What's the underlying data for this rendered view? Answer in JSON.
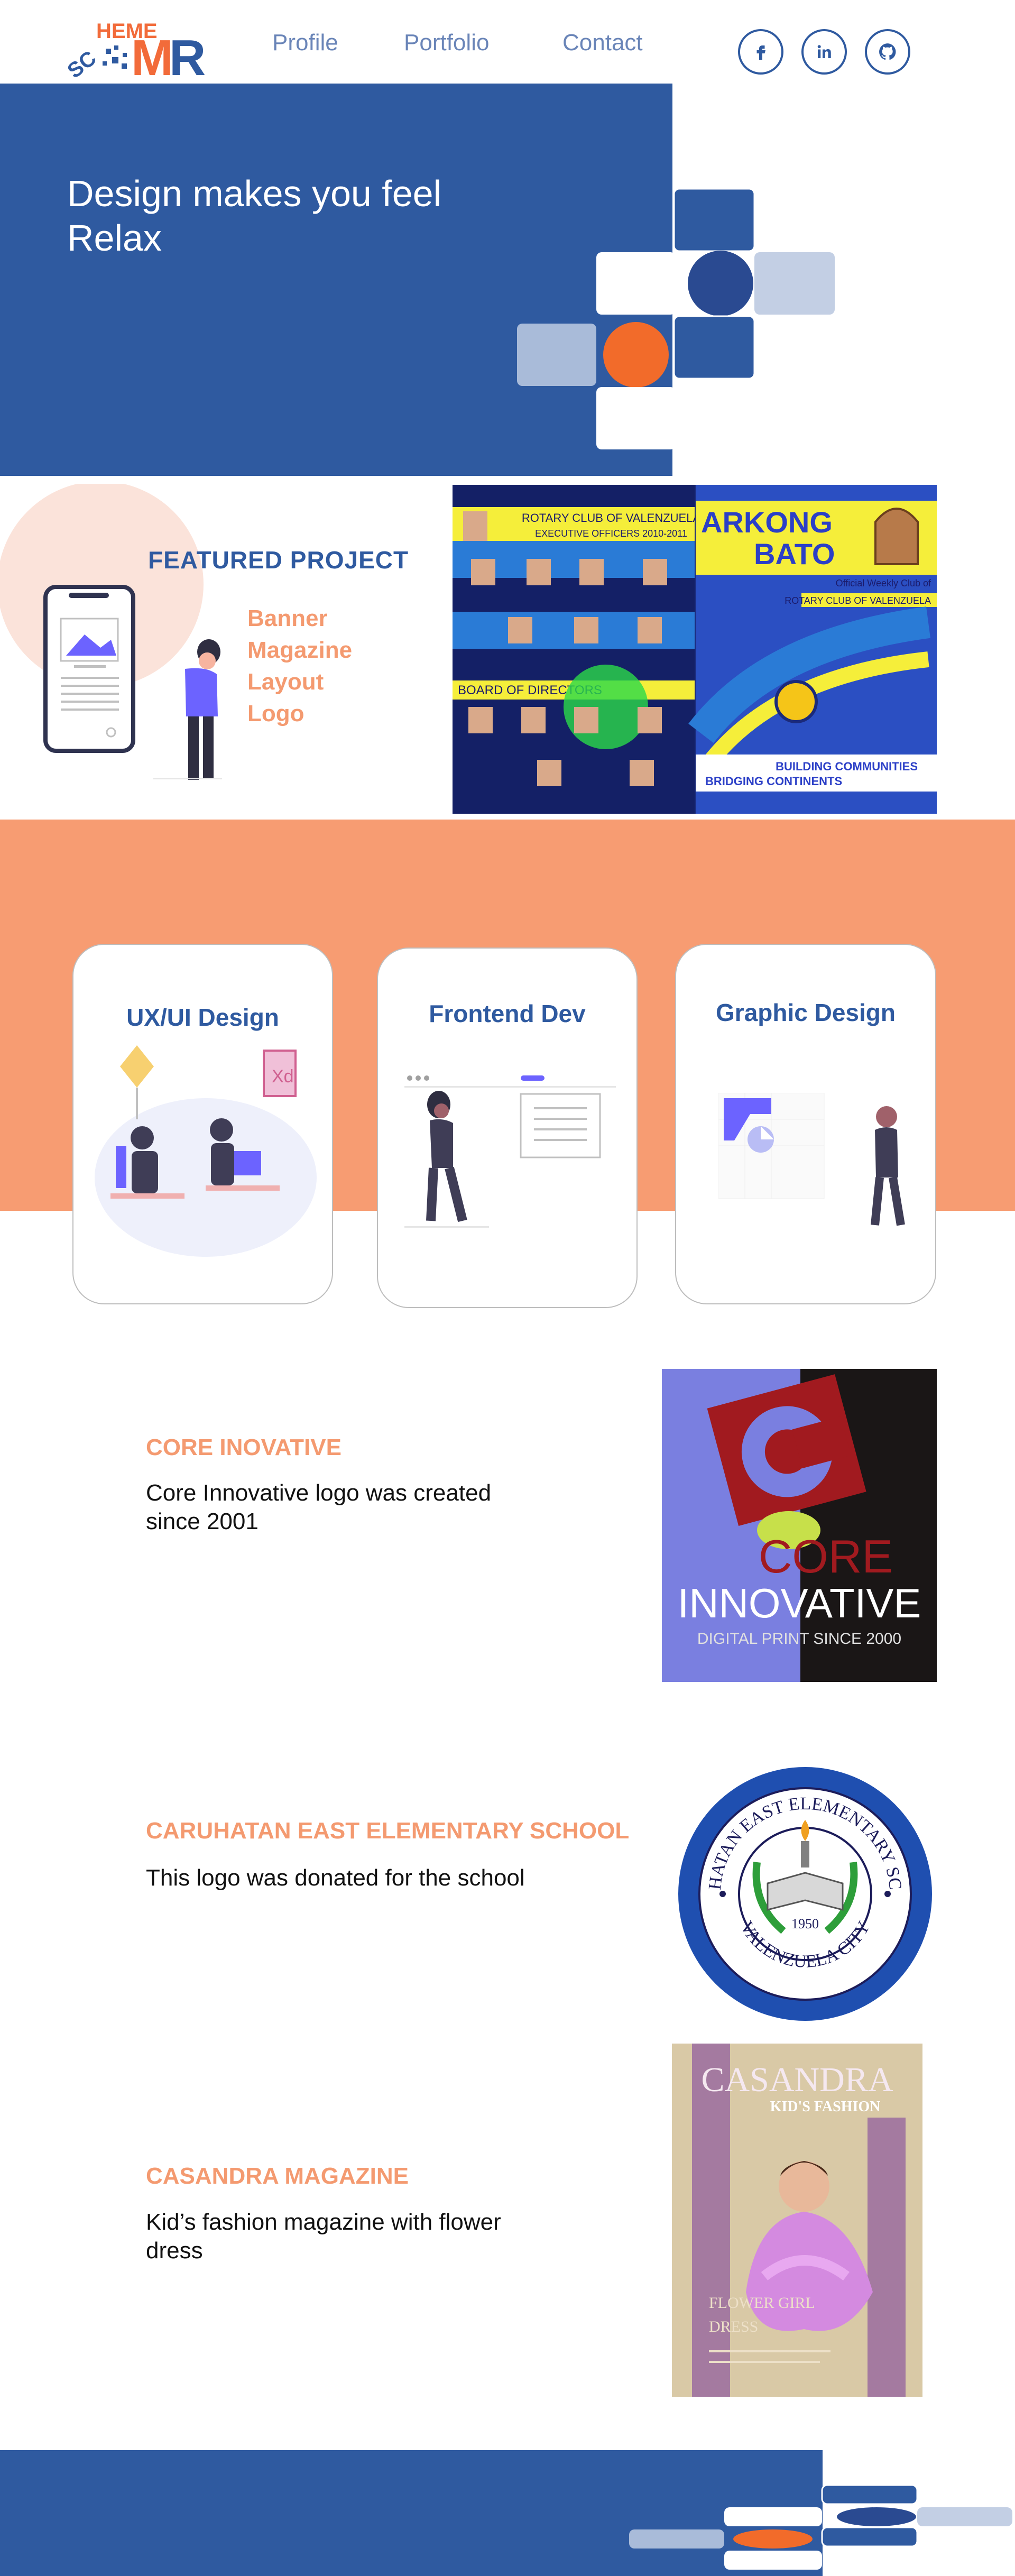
{
  "brand": {
    "logo_line1": "SCHEME",
    "logo_line2": "MR"
  },
  "nav": {
    "links": [
      "Profile",
      "Portfolio",
      "Contact"
    ],
    "social": [
      "facebook-icon",
      "linkedin-icon",
      "github-icon"
    ]
  },
  "hero": {
    "title": "Design makes you feel Relax"
  },
  "featured": {
    "heading": "FEATURED PROJECT",
    "items": [
      "Banner",
      "Magazine",
      "Layout",
      "Logo"
    ],
    "banner": {
      "left_title": "ROTARY CLUB OF VALENZUELA",
      "left_subtitle": "EXECUTIVE OFFICERS 2010-2011",
      "board": "BOARD OF DIRECTORS",
      "right_title1": "ARKONG",
      "right_title2": "BATO",
      "right_sub1": "Official Weekly Club of",
      "right_sub2": "ROTARY CLUB OF VALENZUELA",
      "tag1": "BUILDING COMMUNITIES",
      "tag2": "BRIDGING CONTINENTS"
    }
  },
  "services": {
    "cards": [
      {
        "title": "UX/UI Design"
      },
      {
        "title": "Frontend Dev"
      },
      {
        "title": "Graphic Design"
      }
    ]
  },
  "projects": [
    {
      "title": "CORE INOVATIVE",
      "description": "Core Innovative logo was created since 2001",
      "image_text": [
        "CORE",
        "INNOVATIVE",
        "DIGITAL PRINT SINCE 2000"
      ]
    },
    {
      "title": "CARUHATAN EAST ELEMENTARY SCHOOL",
      "description": "This logo was donated for the school",
      "image_text": [
        "CARUHATAN EAST ELEMENTARY SCHOOL",
        "VALENZUELA CITY",
        "1950"
      ]
    },
    {
      "title": "CASANDRA MAGAZINE",
      "description": "Kid’s fashion magazine with flower dress",
      "image_text": [
        "CASANDRA",
        "KID'S FASHION",
        "FLOWER GIRL",
        "DRESS"
      ]
    }
  ],
  "colors": {
    "primary_blue": "#2f5aa0",
    "accent_orange": "#f79c72",
    "light_blue": "#c3cfe4",
    "peach": "#fbe3da"
  }
}
